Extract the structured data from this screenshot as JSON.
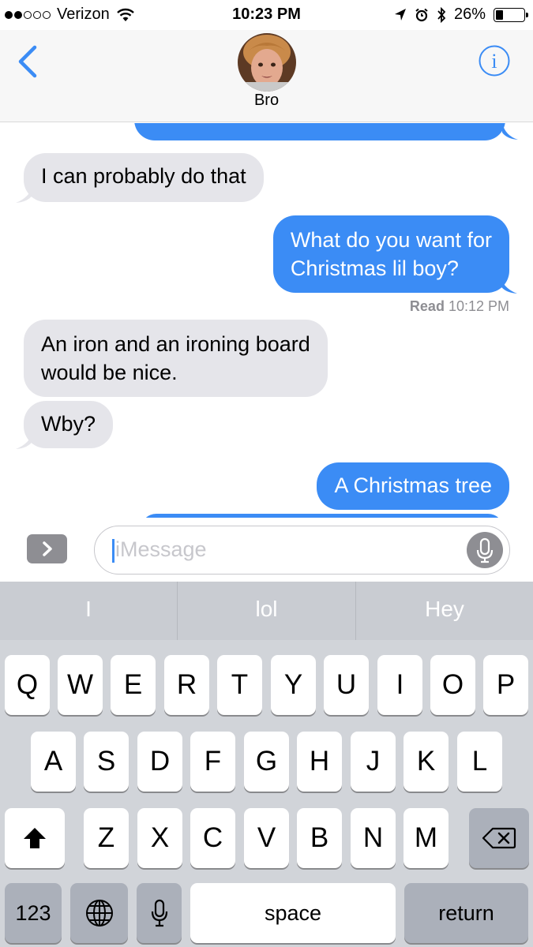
{
  "status_bar": {
    "carrier": "Verizon",
    "signal_bars": 2,
    "time": "10:23 PM",
    "battery": "26%",
    "battery_level": 0.26
  },
  "header": {
    "contact_name": "Bro"
  },
  "messages": [
    {
      "direction": "in",
      "text": "I can probably do that"
    },
    {
      "direction": "out",
      "lines": [
        "What do you want for",
        "Christmas lil boy?"
      ]
    },
    {
      "direction": "in",
      "lines": [
        "An iron and an ironing board",
        "would be nice."
      ]
    },
    {
      "direction": "in",
      "text": "Wby?"
    },
    {
      "direction": "out",
      "text": "A Christmas tree"
    }
  ],
  "read_receipt": {
    "label": "Read",
    "time": "10:12 PM"
  },
  "input": {
    "placeholder": "iMessage"
  },
  "keyboard": {
    "predictions": [
      "I",
      "lol",
      "Hey"
    ],
    "row1": [
      "Q",
      "W",
      "E",
      "R",
      "T",
      "Y",
      "U",
      "I",
      "O",
      "P"
    ],
    "row2": [
      "A",
      "S",
      "D",
      "F",
      "G",
      "H",
      "J",
      "K",
      "L"
    ],
    "row3": [
      "Z",
      "X",
      "C",
      "V",
      "B",
      "N",
      "M"
    ],
    "numbers_label": "123",
    "space_label": "space",
    "return_label": "return"
  },
  "colors": {
    "accent": "#3b8cf5",
    "incoming_bubble": "#e5e5ea",
    "keyboard_bg": "#d1d4d9"
  }
}
